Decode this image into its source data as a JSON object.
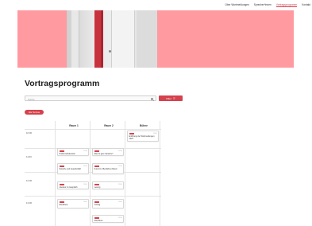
{
  "nav": {
    "items": [
      {
        "label": "Über Wortmeldungen",
        "active": false
      },
      {
        "label": "Sprecher*innen",
        "active": false
      },
      {
        "label": "Vortragsprogramm",
        "active": true
      },
      {
        "label": "Kontakt",
        "active": false
      }
    ]
  },
  "page": {
    "title": "Vortragsprogramm"
  },
  "search": {
    "placeholder": "Suche",
    "filter_label": "Filter"
  },
  "action_pill": "Alle Termine",
  "schedule": {
    "columns": [
      "Raum 1",
      "Raum 2",
      "Bühne"
    ],
    "times": [
      "10:00",
      "11:00",
      "12:00",
      "13:00"
    ],
    "cards": [
      {
        "col": 2,
        "row": 0,
        "tag": "Talk",
        "meta": "10:00",
        "title": "Eröffnung der Wortmeldungen 2023"
      },
      {
        "col": 0,
        "row": 1,
        "tag": "Talk",
        "meta": "10:30",
        "title": "Podiumsdiskussion"
      },
      {
        "col": 1,
        "row": 1,
        "tag": "Talk",
        "meta": "10:30",
        "title": "Was ist gute Sprache?"
      },
      {
        "col": 0,
        "row": 2,
        "tag": "Talk",
        "meta": "11:00",
        "title": "Sprache und Gesellschaft"
      },
      {
        "col": 1,
        "row": 2,
        "tag": "Talk",
        "meta": "11:00",
        "title": "Kunst im öffentlichen Raum"
      },
      {
        "col": 0,
        "row": 3,
        "tag": "Talk",
        "meta": "12:00",
        "title": "Literatur im Gespräch"
      },
      {
        "col": 1,
        "row": 3,
        "tag": "Talk",
        "meta": "12:00",
        "title": "Lesung"
      },
      {
        "col": 0,
        "row": 4,
        "tag": "Talk",
        "meta": "13:00",
        "title": "Workshop"
      },
      {
        "col": 1,
        "row": 4,
        "tag": "Talk",
        "meta": "13:00",
        "title": "Vortrag"
      },
      {
        "col": 1,
        "row": 5,
        "tag": "Talk",
        "meta": "13:30",
        "title": "Abschluss"
      }
    ]
  }
}
